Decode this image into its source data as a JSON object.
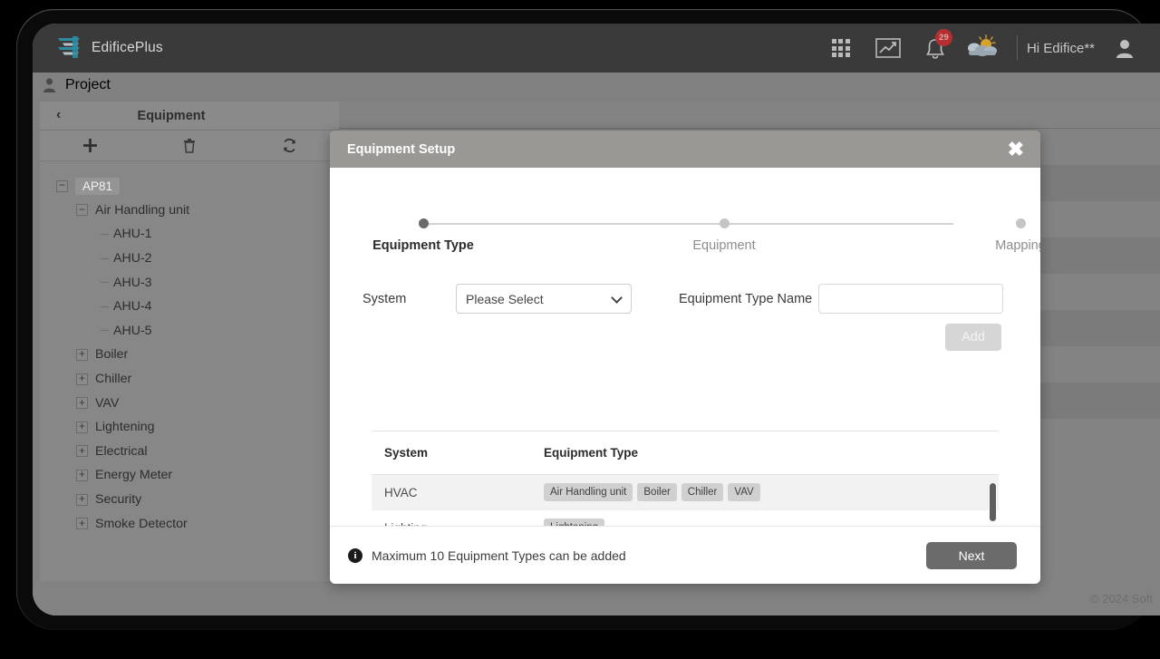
{
  "navbar": {
    "brand": "EdificePlus",
    "apps_icon": "grid-apps-icon",
    "analytics_icon": "line-chart-icon",
    "notifications_icon": "bell-icon",
    "notification_count": "29",
    "weather_icon": "sun-behind-cloud-icon",
    "greeting": "Hi Edifice**",
    "avatar_icon": "user-avatar-icon"
  },
  "breadcrumb": {
    "icon": "user-icon",
    "label": "Project"
  },
  "left_panel": {
    "back_icon": "chevron-left-icon",
    "title": "Equipment",
    "toolbar": {
      "add_icon": "plus-icon",
      "delete_icon": "trash-icon",
      "refresh_icon": "refresh-icon"
    },
    "tree": [
      {
        "label": "AP81",
        "level": 1,
        "toggle": "minus",
        "chip": true
      },
      {
        "label": "Air Handling unit",
        "level": 2,
        "toggle": "minus",
        "chip": false
      },
      {
        "label": "AHU-1",
        "level": 3,
        "toggle": "none",
        "chip": false
      },
      {
        "label": "AHU-2",
        "level": 3,
        "toggle": "none",
        "chip": false
      },
      {
        "label": "AHU-3",
        "level": 3,
        "toggle": "none",
        "chip": false
      },
      {
        "label": "AHU-4",
        "level": 3,
        "toggle": "none",
        "chip": false
      },
      {
        "label": "AHU-5",
        "level": 3,
        "toggle": "none",
        "chip": false
      },
      {
        "label": "Boiler",
        "level": 2,
        "toggle": "plus",
        "chip": false
      },
      {
        "label": "Chiller",
        "level": 2,
        "toggle": "plus",
        "chip": false
      },
      {
        "label": "VAV",
        "level": 2,
        "toggle": "plus",
        "chip": false
      },
      {
        "label": "Lightening",
        "level": 2,
        "toggle": "plus",
        "chip": false
      },
      {
        "label": "Electrical",
        "level": 2,
        "toggle": "plus",
        "chip": false
      },
      {
        "label": "Energy Meter",
        "level": 2,
        "toggle": "plus",
        "chip": false
      },
      {
        "label": "Security",
        "level": 2,
        "toggle": "plus",
        "chip": false
      },
      {
        "label": "Smoke Detector",
        "level": 2,
        "toggle": "plus",
        "chip": false
      }
    ]
  },
  "modal": {
    "title": "Equipment Setup",
    "close_icon": "close-icon",
    "steps": [
      {
        "label": "Equipment Type",
        "active": true
      },
      {
        "label": "Equipment",
        "active": false
      },
      {
        "label": "Mapping",
        "active": false
      }
    ],
    "form": {
      "system_label": "System",
      "system_value": "Please Select",
      "system_options": [
        "Please Select"
      ],
      "caret_icon": "chevron-down-icon",
      "equipment_type_name_label": "Equipment Type Name",
      "equipment_type_name_value": "",
      "equipment_type_name_placeholder": "",
      "add_label": "Add"
    },
    "table": {
      "columns": [
        "System",
        "Equipment Type"
      ],
      "rows": [
        {
          "system": "HVAC",
          "types": [
            "Air Handling unit",
            "Boiler",
            "Chiller",
            "VAV"
          ]
        },
        {
          "system": "Lighting",
          "types": [
            "Lightening"
          ]
        },
        {
          "system": "",
          "types": [
            ""
          ]
        }
      ]
    },
    "footer": {
      "info_icon": "info-icon",
      "info_text": "Maximum 10 Equipment Types can be added",
      "next_label": "Next"
    }
  },
  "footer": {
    "copyright": "© 2024 Soft"
  },
  "colors": {
    "brand_teal": "#2e8ba0",
    "modal_header": "#9a9894",
    "next_button": "#6b6b6b",
    "badge_red": "#b43030",
    "step_active": "#6b6b6b"
  }
}
